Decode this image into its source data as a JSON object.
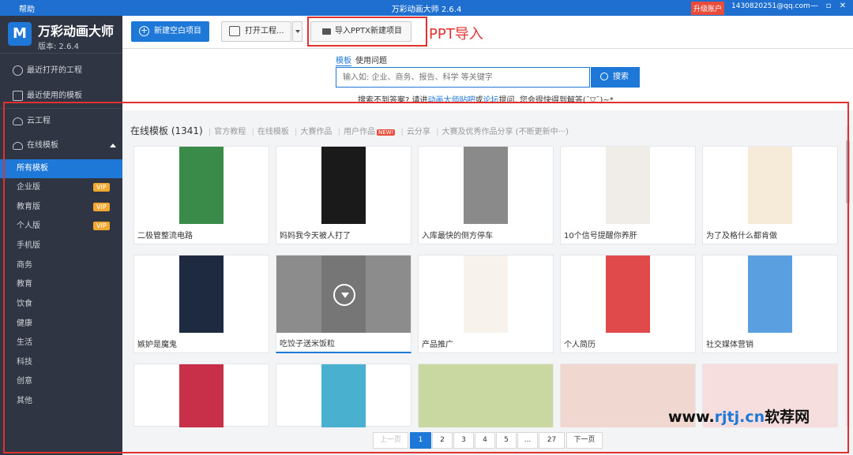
{
  "titlebar": {
    "help": "帮助",
    "title": "万彩动画大师 2.6.4",
    "upgrade": "升级账户",
    "email": "1430820251@qq.com",
    "minimize": "—",
    "restore": "▫",
    "close": "✕"
  },
  "sidebar": {
    "app_name": "万彩动画大师",
    "app_logo_letter": "M",
    "version": "版本: 2.6.4",
    "recent_projects": "最近打开的工程",
    "recent_templates": "最近使用的模板",
    "cloud_project": "云工程",
    "online_templates": "在线模板",
    "categories": [
      {
        "label": "所有模板",
        "vip": ""
      },
      {
        "label": "企业版",
        "vip": "VIP"
      },
      {
        "label": "教育版",
        "vip": "VIP"
      },
      {
        "label": "个人版",
        "vip": "VIP"
      },
      {
        "label": "手机版",
        "vip": ""
      },
      {
        "label": "商务",
        "vip": ""
      },
      {
        "label": "教育",
        "vip": ""
      },
      {
        "label": "饮食",
        "vip": ""
      },
      {
        "label": "健康",
        "vip": ""
      },
      {
        "label": "生活",
        "vip": ""
      },
      {
        "label": "科技",
        "vip": ""
      },
      {
        "label": "创意",
        "vip": ""
      },
      {
        "label": "其他",
        "vip": ""
      }
    ]
  },
  "toolbar": {
    "new_blank": "新建空白项目",
    "open_project": "打开工程...",
    "import_pptx": "导入PPTX新建项目"
  },
  "annotation": {
    "ppt_import": "PPT导入"
  },
  "search": {
    "tab_templates": "模板",
    "tab_faq": "使用问题",
    "placeholder": "输入如: 企业、商务、报告、科学 等关键字",
    "button": "搜索",
    "help_prefix": "搜索不到答案? 请进",
    "help_link1": "动画大师贴吧",
    "help_mid": "或",
    "help_link2": "论坛",
    "help_suffix": "提问, 您会很快得到解答(ˉ▽ˉ)~*"
  },
  "content": {
    "cat_main": "在线模板 (1341)",
    "cat_tabs": [
      "官方教程",
      "在线模板",
      "大赛作品",
      "用户作品",
      "云分享",
      "大赛及优秀作品分享 (不断更新中···)"
    ],
    "new_badge": "NEW!",
    "templates": [
      {
        "title": "二极管整流电路",
        "color": "#3a8a4a"
      },
      {
        "title": "妈妈我今天被人打了",
        "color": "#1a1a1a"
      },
      {
        "title": "入库最快的侧方停车",
        "color": "#8a8a8a"
      },
      {
        "title": "10个信号提醒你养肝",
        "color": "#f0ede8"
      },
      {
        "title": "为了及格什么都肯做",
        "color": "#f6ead8"
      },
      {
        "title": "嫉妒是魔鬼",
        "color": "#1e2a40"
      },
      {
        "title": "吃饺子送米饭粒",
        "color": "#d8d8d8"
      },
      {
        "title": "产品推广",
        "color": "#f7f3ec"
      },
      {
        "title": "个人简历",
        "color": "#e04a4a"
      },
      {
        "title": "社交媒体营销",
        "color": "#5aa0e0"
      },
      {
        "title": "",
        "color": "#c8304a"
      },
      {
        "title": "",
        "color": "#4ab0d0"
      },
      {
        "title": "",
        "color": "#c8d8a0"
      },
      {
        "title": "",
        "color": "#f0d8d0"
      },
      {
        "title": "",
        "color": "#f6dede"
      }
    ],
    "pager": [
      "上一页",
      "1",
      "2",
      "3",
      "4",
      "5",
      "...",
      "27",
      "下一页"
    ]
  },
  "watermark": {
    "text1": "www.",
    "text2": "rjtj.cn",
    "text3": "软荐网"
  }
}
